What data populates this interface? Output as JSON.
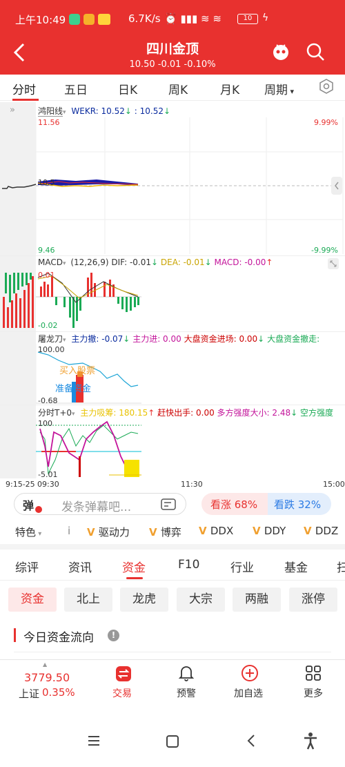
{
  "status_bar": {
    "time": "上午10:49",
    "speed": "6.7K/s",
    "battery": "10"
  },
  "header": {
    "title": "四川金顶",
    "subtitle": "10.50 -0.01 -0.10%"
  },
  "period_tabs": [
    "分时",
    "五日",
    "日K",
    "周K",
    "月K",
    "周期"
  ],
  "wekr": {
    "indicator_name": "鸿阳线",
    "label": "WEKR: 10.52",
    "label2": ": 10.52"
  },
  "price_chart": {
    "max_price": "11.56",
    "min_price": "9.46",
    "max_pct": "9.99%",
    "min_pct": "-9.99%",
    "open_label": "10.5"
  },
  "macd": {
    "name": "MACD",
    "params": "(12,26,9)",
    "dif": "DIF: -0.01",
    "dea": "DEA: -0.01",
    "macd": "MACD: -0.00",
    "top_val": "0.01",
    "bottom_val": "-0.02"
  },
  "tulongdao": {
    "name": "屠龙刀",
    "zhuli_che": "主力撤: -0.07",
    "zhuli_jin": "主力进: 0.00",
    "dapan_in": "大盘资金进场: 0.00",
    "dapan_out": "大盘资金撤走:",
    "top_val": "100.00",
    "bottom_val": "-0.68",
    "buy_text": "买入股票",
    "prep_text": "准备资金"
  },
  "t0": {
    "name": "分时T+0",
    "xishou": "主力吸筹: 180.15",
    "ganchu": "赶快出手: 0.00",
    "duofang": "多方强度大小: 2.48",
    "kongfang": "空方强度",
    "top_val": "100",
    "bottom_val": "-5.01"
  },
  "time_axis": {
    "t1": "9:15-25",
    "t2": "09:30",
    "t3": "11:30",
    "t4": "15:00"
  },
  "danmu": {
    "placeholder": "发条弹幕吧...",
    "badge": "弹"
  },
  "sentiment": {
    "up": "看涨 68%",
    "down": "看跌 32%",
    "up_pct": 68
  },
  "feature_bar": {
    "special": "特色",
    "items": [
      "驱动力",
      "博弈",
      "DDX",
      "DDY",
      "DDZ"
    ]
  },
  "info_tabs": [
    "综评",
    "资讯",
    "资金",
    "F10",
    "行业",
    "基金",
    "扫"
  ],
  "fund_chips": [
    "资金",
    "北上",
    "龙虎",
    "大宗",
    "两融",
    "涨停"
  ],
  "section_title": "今日资金流向",
  "bottom_nav": {
    "index_value": "3779.50",
    "index_name": "上证",
    "index_pct": "0.35%",
    "items": [
      "交易",
      "预警",
      "加自选",
      "更多"
    ]
  },
  "colors": {
    "brand": "#e8312f",
    "up": "#e8312f",
    "down": "#1aaa55"
  }
}
